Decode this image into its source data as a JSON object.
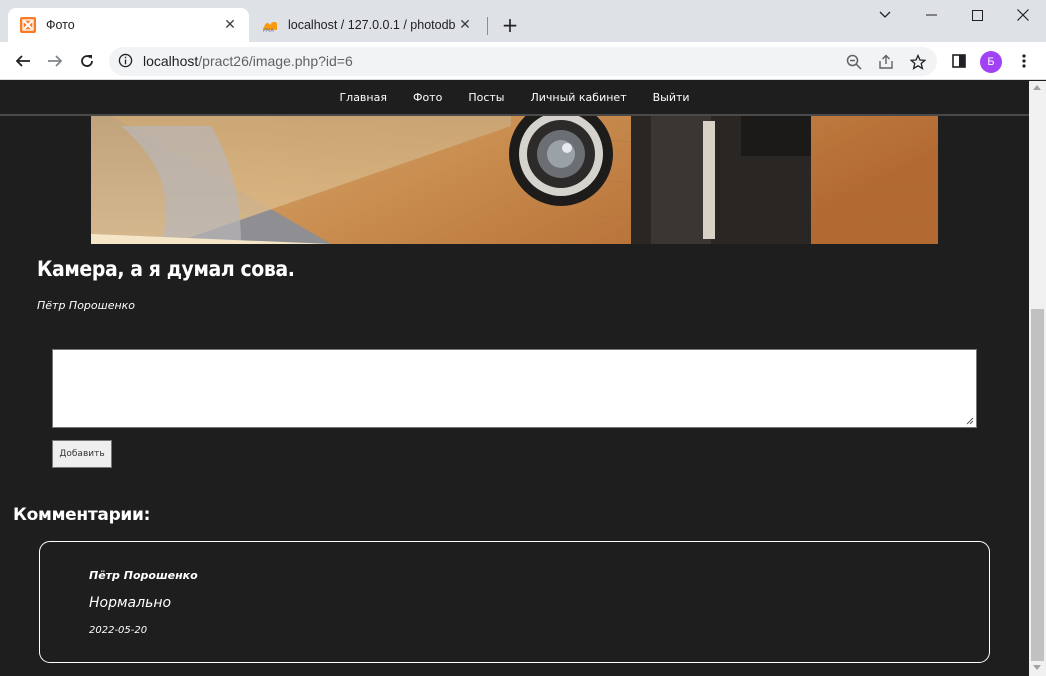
{
  "browser": {
    "tabs": [
      {
        "title": "Фото",
        "active": true,
        "icon": "xampp-icon"
      },
      {
        "title": "localhost / 127.0.0.1 / photodb /",
        "active": false,
        "icon": "phpmyadmin-icon"
      }
    ],
    "address": {
      "host": "localhost",
      "path": "/pract26/image.php?id=6"
    },
    "profile_initial": "Б",
    "accent_color": "#a142f4"
  },
  "nav": {
    "items": [
      {
        "label": "Главная"
      },
      {
        "label": "Фото"
      },
      {
        "label": "Посты"
      },
      {
        "label": "Личный кабинет"
      },
      {
        "label": "Выйти"
      }
    ]
  },
  "post": {
    "title": "Камера, а я думал сова.",
    "author": "Пётр Порошенко",
    "image_subject": "vintage camera on wooden table"
  },
  "comment_form": {
    "value": "",
    "submit_label": "Добавить"
  },
  "comments": {
    "heading": "Комментарии:",
    "items": [
      {
        "author": "Пётр Порошенко",
        "text": "Нормально",
        "date": "2022-05-20"
      }
    ]
  },
  "colors": {
    "page_bg": "#1e1e1e",
    "text": "#ffffff"
  }
}
